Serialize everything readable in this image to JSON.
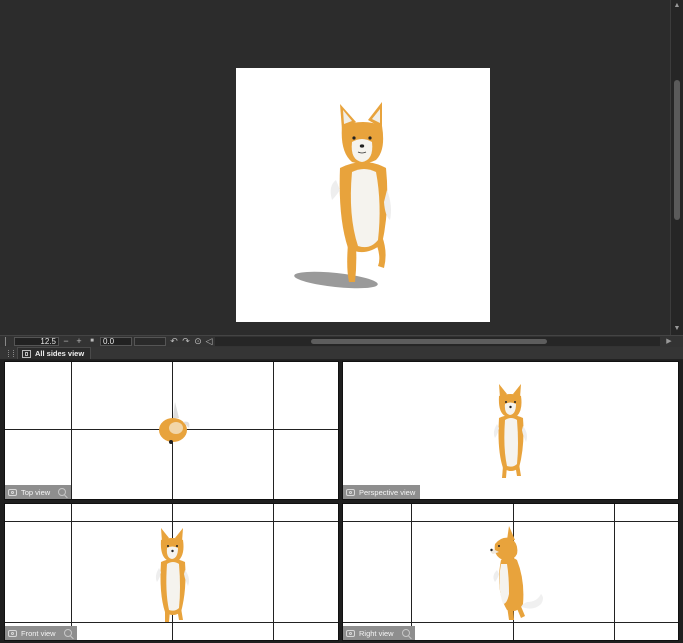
{
  "status_bar": {
    "zoom_value": "12.5",
    "zoom_out": "−",
    "zoom_in": "+",
    "fit": "■",
    "angle_value": "0.0",
    "rotate_left": "↶",
    "rotate_right": "↷",
    "reset": "⊙",
    "flip": "◁"
  },
  "palette": {
    "tab_label": "All sides view"
  },
  "views": {
    "top": "Top view",
    "perspective": "Perspective view",
    "front": "Front view",
    "right": "Right view"
  },
  "colors": {
    "fur_orange": "#e8a33c",
    "fur_white": "#f5f3ee",
    "background_dark": "#2b2b2b",
    "label_bg": "#8e8e8e"
  }
}
